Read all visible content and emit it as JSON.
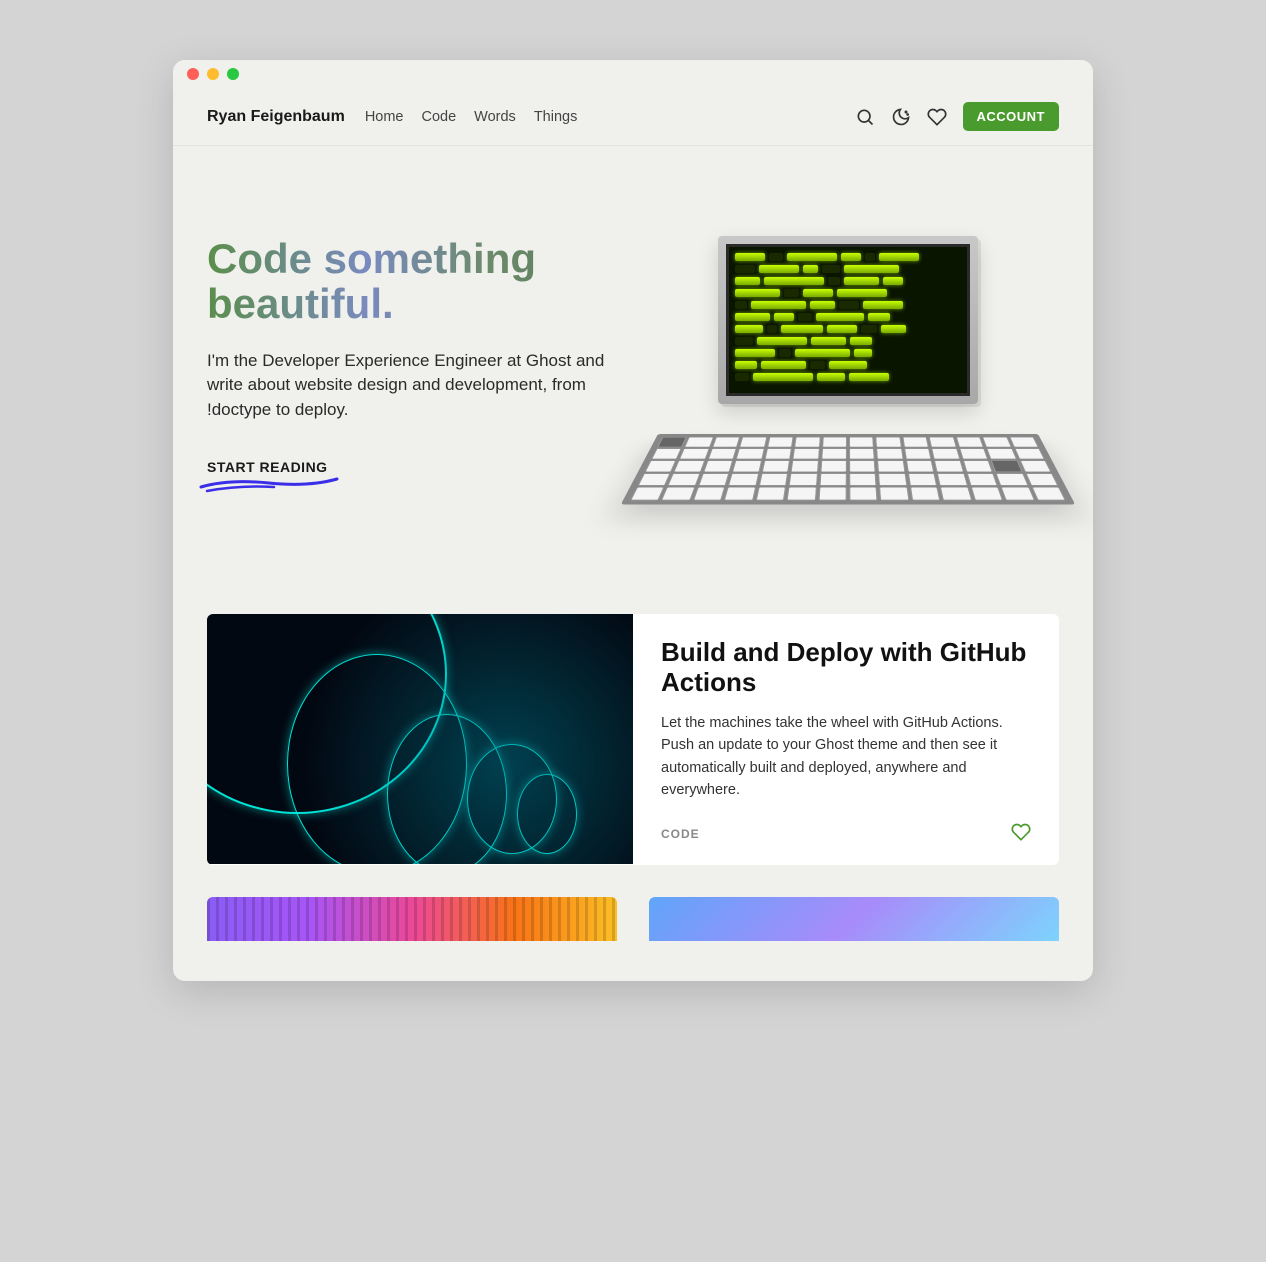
{
  "brand": "Ryan Feigenbaum",
  "nav": {
    "items": [
      "Home",
      "Code",
      "Words",
      "Things"
    ]
  },
  "header": {
    "account_label": "ACCOUNT"
  },
  "hero": {
    "title": "Code something beautiful.",
    "subtitle": "I'm the Developer Experience Engineer at Ghost and write about website design and development, from !doctype to deploy.",
    "cta": "START READING"
  },
  "featured": {
    "title": "Build and Deploy with GitHub Actions",
    "text": "Let the machines take the wheel with GitHub Actions. Push an update to your Ghost theme and then see it automatically built and deployed, anywhere and everywhere.",
    "tag": "CODE"
  }
}
